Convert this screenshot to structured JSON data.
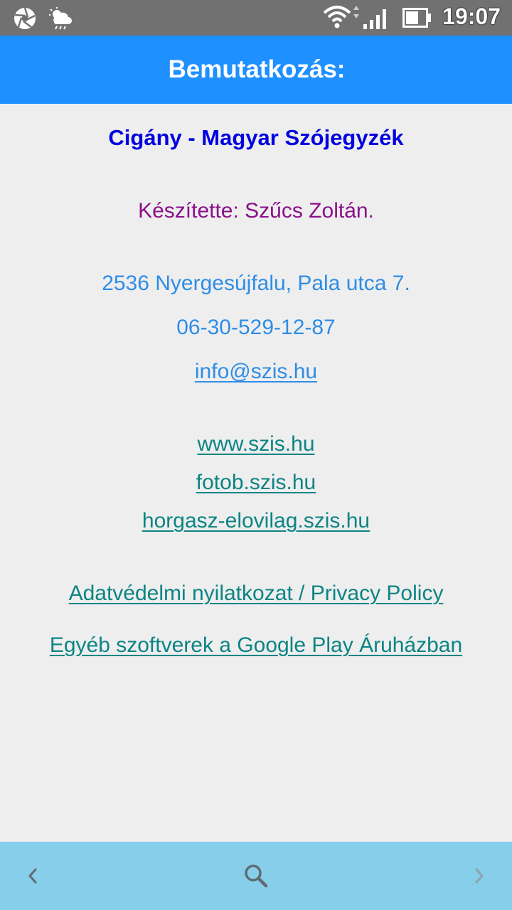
{
  "status_bar": {
    "time": "19:07",
    "icons": [
      "aperture-icon",
      "weather-icon",
      "wifi-icon",
      "signal-icon",
      "battery-icon"
    ]
  },
  "header": {
    "title": "Bemutatkozás:"
  },
  "content": {
    "app_name": "Cigány - Magyar Szójegyzék",
    "author": "Készítette: Szűcs Zoltán.",
    "address": "2536 Nyergesújfalu, Pala utca 7.",
    "phone": "06-30-529-12-87",
    "email": "info@szis.hu",
    "links": [
      {
        "label": "www.szis.hu"
      },
      {
        "label": "fotob.szis.hu"
      },
      {
        "label": "horgasz-elovilag.szis.hu"
      }
    ],
    "privacy_label": "Adatvédelmi nyilatkozat / Privacy Policy",
    "store_label": "Egyéb szoftverek a Google Play Áruházban"
  },
  "bottom_bar": {
    "icons": [
      "chevron-left-icon",
      "search-icon",
      "chevron-right-icon"
    ]
  },
  "colors": {
    "status_bar": "#717171",
    "app_bar": "#1e90ff",
    "app_name": "#0000e0",
    "author": "#8b0f8b",
    "contact": "#2e8de6",
    "links": "#0c8484",
    "bottom_bar": "#87ceeb",
    "background": "#eeeeee"
  }
}
